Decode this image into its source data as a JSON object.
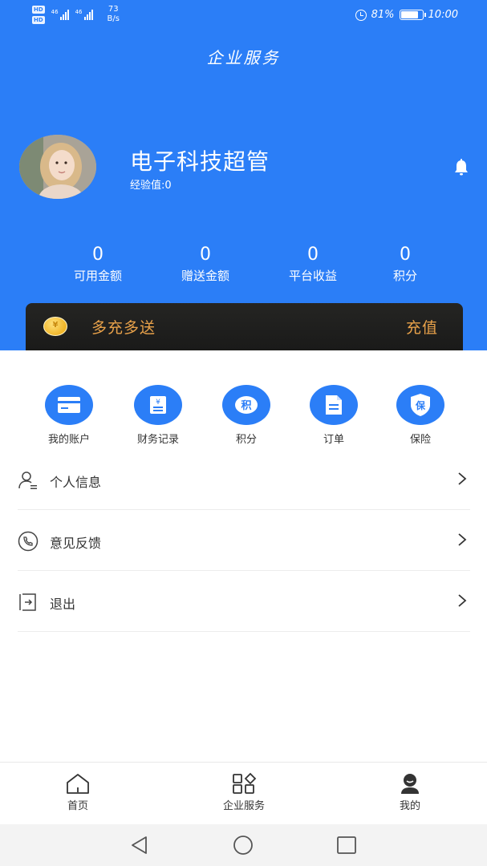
{
  "status_bar": {
    "net_speed_value": "73",
    "net_speed_unit": "B/s",
    "signal_label_1": "46",
    "signal_label_2": "46",
    "hd_label": "HD",
    "battery_text": "81%",
    "time": "10:00"
  },
  "header": {
    "title": "企业服务",
    "user_name": "电子科技超管",
    "exp_text": "经验值:0",
    "bg_color": "#2b7ef7"
  },
  "stats": [
    {
      "value": "0",
      "label": "可用金额"
    },
    {
      "value": "0",
      "label": "赠送金额"
    },
    {
      "value": "0",
      "label": "平台收益"
    },
    {
      "value": "0",
      "label": "积分"
    }
  ],
  "promo": {
    "coin_symbol": "¥",
    "text": "多充多送",
    "action": "充值",
    "accent_color": "#e9a24a"
  },
  "quick_actions": [
    {
      "label": "我的账户",
      "icon": "card-icon"
    },
    {
      "label": "财务记录",
      "icon": "receipt-icon"
    },
    {
      "label": "积分",
      "icon": "points-icon",
      "glyph": "积"
    },
    {
      "label": "订单",
      "icon": "document-icon"
    },
    {
      "label": "保险",
      "icon": "shield-icon",
      "glyph": "保"
    }
  ],
  "menu": [
    {
      "label": "个人信息",
      "icon": "user-icon"
    },
    {
      "label": "意见反馈",
      "icon": "phone-icon"
    },
    {
      "label": "退出",
      "icon": "logout-icon"
    }
  ],
  "tabbar": [
    {
      "label": "首页",
      "icon": "home-icon"
    },
    {
      "label": "企业服务",
      "icon": "grid-icon"
    },
    {
      "label": "我的",
      "icon": "profile-icon",
      "active": true
    }
  ]
}
